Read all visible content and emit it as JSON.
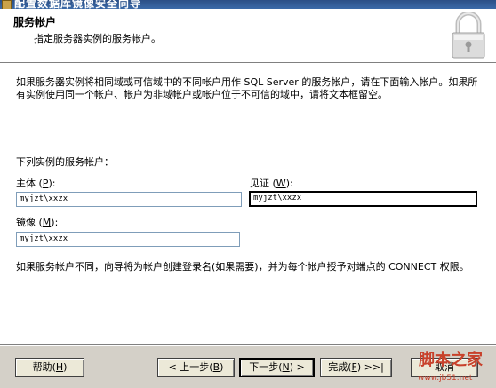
{
  "window": {
    "title": "配置数据库镜像安全向导"
  },
  "header": {
    "title": "服务帐户",
    "subtitle": "指定服务器实例的服务帐户。",
    "icon": "lock-icon"
  },
  "main": {
    "intro": "如果服务器实例将相同域或可信域中的不同帐户用作 SQL Server 的服务帐户，请在下面输入帐户。如果所有实例使用同一个帐户、帐户为非域帐户或帐户位于不可信的域中，请将文本框留空。",
    "section_label": "下列实例的服务帐户：",
    "principal": {
      "label": "主体",
      "hotkey": "P",
      "value": "myjzt\\xxzx"
    },
    "witness": {
      "label": "见证",
      "hotkey": "W",
      "value": "myjzt\\xxzx"
    },
    "mirror": {
      "label": "镜像",
      "hotkey": "M",
      "value": "myjzt\\xxzx"
    },
    "note": "如果服务帐户不同，向导将为帐户创建登录名(如果需要)，并为每个帐户授予对端点的 CONNECT 权限。"
  },
  "buttons": {
    "help": {
      "label": "帮助",
      "hotkey": "H"
    },
    "back": {
      "prefix": "< 上一步",
      "hotkey": "B"
    },
    "next": {
      "prefix": "下一步",
      "hotkey": "N",
      "suffix": " >"
    },
    "finish": {
      "label": "完成",
      "hotkey": "F",
      "suffix": " >>|"
    },
    "cancel": {
      "label": "取消"
    }
  },
  "watermark": {
    "line1": "脚本之家",
    "line2": "www.jb51.net"
  },
  "colors": {
    "title_bar": "#2b4f86",
    "dialog_bg": "#d4d0c8",
    "watermark": "#c8412b"
  }
}
